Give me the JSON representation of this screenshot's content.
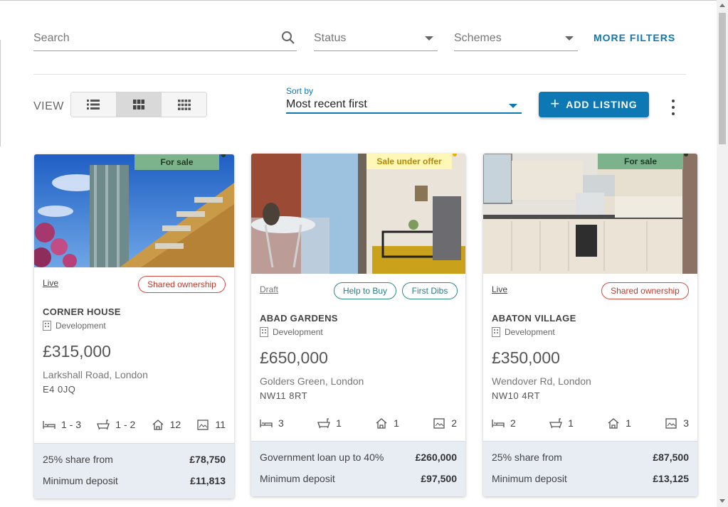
{
  "filters": {
    "search_placeholder": "Search",
    "status_placeholder": "Status",
    "schemes_placeholder": "Schemes",
    "more_filters": "MORE FILTERS"
  },
  "view": {
    "label": "VIEW",
    "modes": [
      "list-view-icon",
      "grid-view-icon",
      "compact-grid-view-icon"
    ],
    "active": "grid-view-icon"
  },
  "sort": {
    "label": "Sort by",
    "value": "Most recent first"
  },
  "add_listing": "ADD LISTING",
  "colors": {
    "primary": "#0d78b4",
    "for_sale": "#7cb38c",
    "offer": "#fff7b8",
    "shared": "#d84a3f",
    "footer": "#e8edf3"
  },
  "listings": [
    {
      "tag": "For sale",
      "status": "Live",
      "chips": [
        "Shared ownership"
      ],
      "name": "CORNER HOUSE",
      "type": "Development",
      "price": "£315,000",
      "address_line1": "Larkshall Road, London",
      "address_line2": "E4 0JQ",
      "beds": "1 - 3",
      "baths": "1 - 2",
      "units": "12",
      "images": "11",
      "footer": [
        {
          "label": "25% share from",
          "value": "£78,750"
        },
        {
          "label": "Minimum deposit",
          "value": "£11,813"
        }
      ]
    },
    {
      "tag": "Sale under offer",
      "status": "Draft",
      "chips": [
        "Help to Buy",
        "First Dibs"
      ],
      "name": "ABAD GARDENS",
      "type": "Development",
      "price": "£650,000",
      "address_line1": "Golders Green, London",
      "address_line2": "NW11 8RT",
      "beds": "3",
      "baths": "1",
      "units": "1",
      "images": "2",
      "footer": [
        {
          "label": "Government loan up to 40%",
          "value": "£260,000"
        },
        {
          "label": "Minimum deposit",
          "value": "£97,500"
        }
      ]
    },
    {
      "tag": "For sale",
      "status": "Live",
      "chips": [
        "Shared ownership"
      ],
      "name": "ABATON VILLAGE",
      "type": "Development",
      "price": "£350,000",
      "address_line1": "Wendover Rd, London",
      "address_line2": "NW10 4RT",
      "beds": "2",
      "baths": "1",
      "units": "1",
      "images": "3",
      "footer": [
        {
          "label": "25% share from",
          "value": "£87,500"
        },
        {
          "label": "Minimum deposit",
          "value": "£13,125"
        }
      ]
    }
  ]
}
